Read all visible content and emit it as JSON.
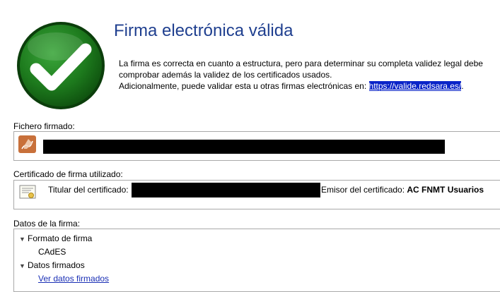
{
  "header": {
    "title": "Firma electrónica válida",
    "line1": "La firma es correcta en cuanto a estructura, pero para determinar su completa validez legal debe",
    "line2": "comprobar además la validez de los certificados usados.",
    "line3_prefix": "Adicionalmente, puede validar esta u otras firmas electrónicas en: ",
    "line3_link": "https://valide.redsara.es/",
    "line3_suffix": "."
  },
  "file_section": {
    "label": "Fichero firmado:"
  },
  "cert_section": {
    "label": "Certificado de firma utilizado:",
    "holder_label": "Titular del certificado:",
    "issuer_label": "Emisor del certificado:",
    "issuer_value": "AC FNMT Usuarios"
  },
  "data_section": {
    "label": "Datos de la firma:",
    "items": [
      {
        "label": "Formato de firma",
        "child": "CAdES"
      },
      {
        "label": "Datos firmados",
        "child": "Ver datos firmados"
      }
    ]
  },
  "colors": {
    "title": "#1f3f8f",
    "check_bg": "#1d7a1d",
    "link": "#1a2fb5",
    "selection": "#0a24c8"
  }
}
